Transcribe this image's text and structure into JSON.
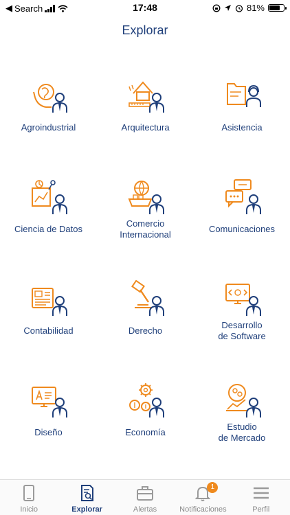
{
  "status": {
    "back_app": "Search",
    "time": "17:48",
    "battery": "81%",
    "battery_level": 0.81
  },
  "page": {
    "title": "Explorar"
  },
  "categories": [
    {
      "label": "Agroindustrial"
    },
    {
      "label": "Arquitectura"
    },
    {
      "label": "Asistencia"
    },
    {
      "label": "Ciencia de Datos"
    },
    {
      "label_line1": "Comercio",
      "label_line2": "Internacional"
    },
    {
      "label": "Comunicaciones"
    },
    {
      "label": "Contabilidad"
    },
    {
      "label": "Derecho"
    },
    {
      "label_line1": "Desarrollo",
      "label_line2": "de Software"
    },
    {
      "label": "Diseño"
    },
    {
      "label": "Economía"
    },
    {
      "label_line1": "Estudio",
      "label_line2": "de Mercado"
    }
  ],
  "tabs": [
    {
      "label": "Inicio",
      "icon": "phone-icon"
    },
    {
      "label": "Explorar",
      "icon": "search-document-icon",
      "active": true
    },
    {
      "label": "Alertas",
      "icon": "briefcase-icon"
    },
    {
      "label": "Notificaciones",
      "icon": "bell-icon",
      "badge": "1"
    },
    {
      "label": "Perfil",
      "icon": "menu-icon"
    }
  ],
  "colors": {
    "primary": "#1f3f7a",
    "accent": "#ef8a1e"
  }
}
